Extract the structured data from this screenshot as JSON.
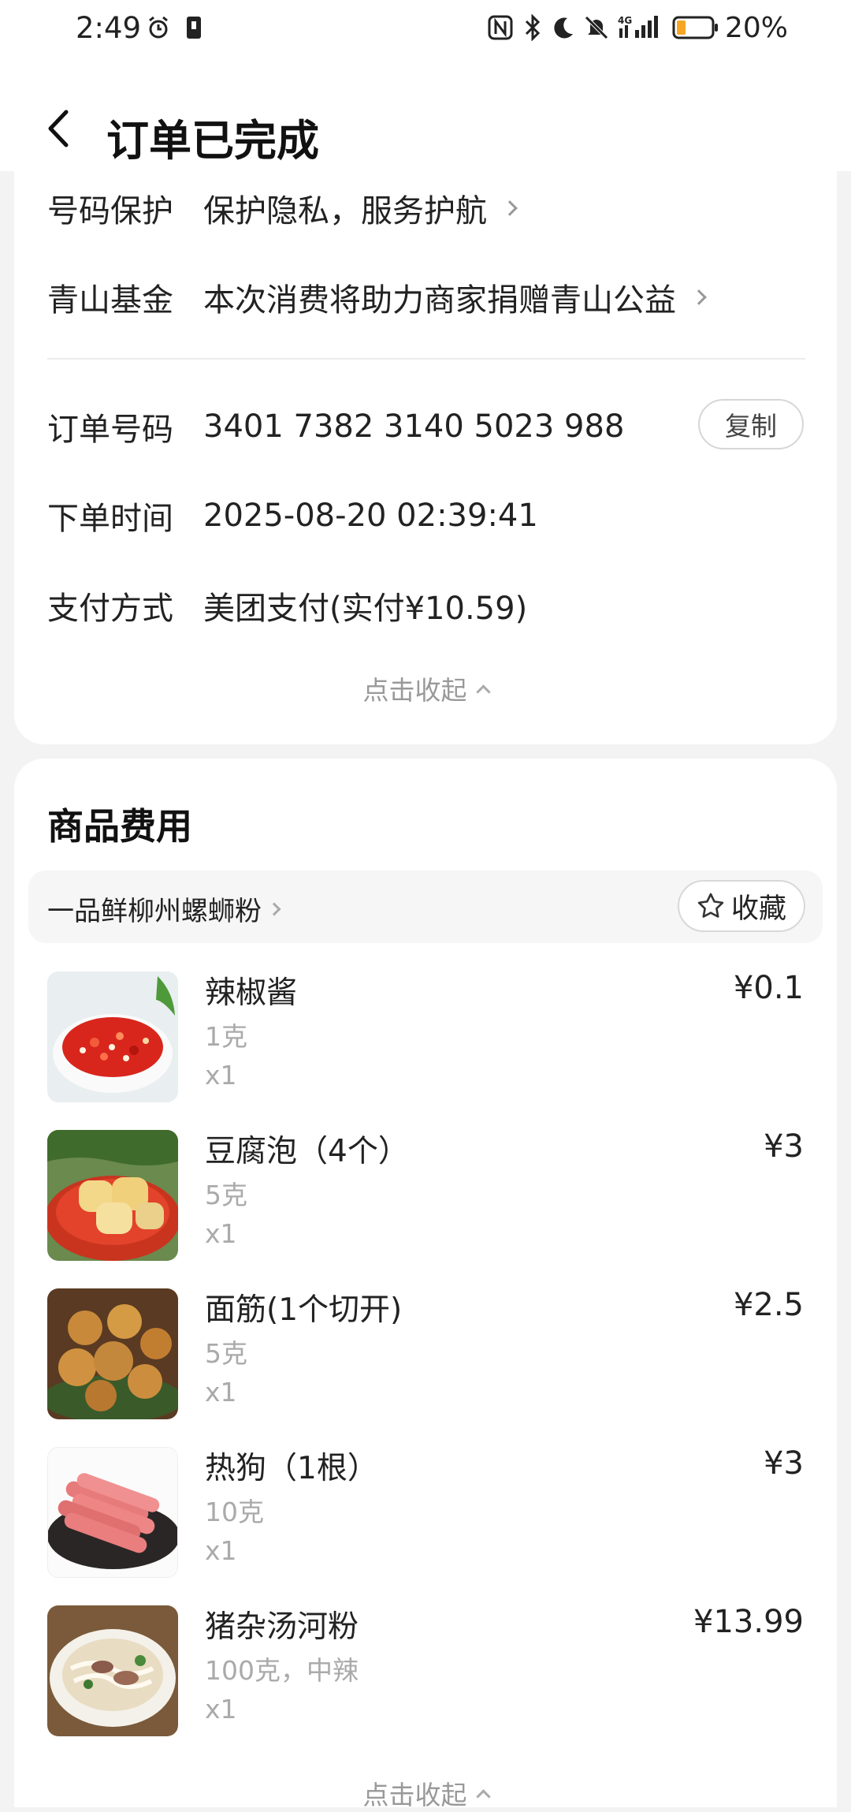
{
  "status_bar": {
    "time": "2:49",
    "battery": "20%",
    "network": "4G"
  },
  "header": {
    "title": "订单已完成"
  },
  "order_info": {
    "rows": [
      {
        "label": "号码保护",
        "value": "保护隐私，服务护航"
      },
      {
        "label": "青山基金",
        "value": "本次消费将助力商家捐赠青山公益"
      },
      {
        "label": "订单号码",
        "value": "3401 7382 3140 5023 988"
      },
      {
        "label": "下单时间",
        "value": "2025-08-20 02:39:41"
      },
      {
        "label": "支付方式",
        "value": "美团支付(实付¥10.59)"
      }
    ],
    "copy_label": "复制",
    "collapse_label": "点击收起"
  },
  "goods": {
    "title": "商品费用",
    "shop_name": "一品鲜柳州螺蛳粉",
    "favorite_label": "收藏",
    "items": [
      {
        "name": "辣椒酱",
        "spec": "1克",
        "qty": "x1",
        "price": "¥0.1"
      },
      {
        "name": "豆腐泡（4个）",
        "spec": "5克",
        "qty": "x1",
        "price": "¥3"
      },
      {
        "name": "面筋(1个切开)",
        "spec": "5克",
        "qty": "x1",
        "price": "¥2.5"
      },
      {
        "name": "热狗（1根）",
        "spec": "10克",
        "qty": "x1",
        "price": "¥3"
      },
      {
        "name": "猪杂汤河粉",
        "spec": "100克，中辣",
        "qty": "x1",
        "price": "¥13.99"
      }
    ],
    "collapse_label": "点击收起"
  },
  "colors": {
    "background": "#f3f3f3",
    "card": "#ffffff",
    "battery_fill": "#f5a623",
    "muted_text": "#aaaaaa"
  }
}
